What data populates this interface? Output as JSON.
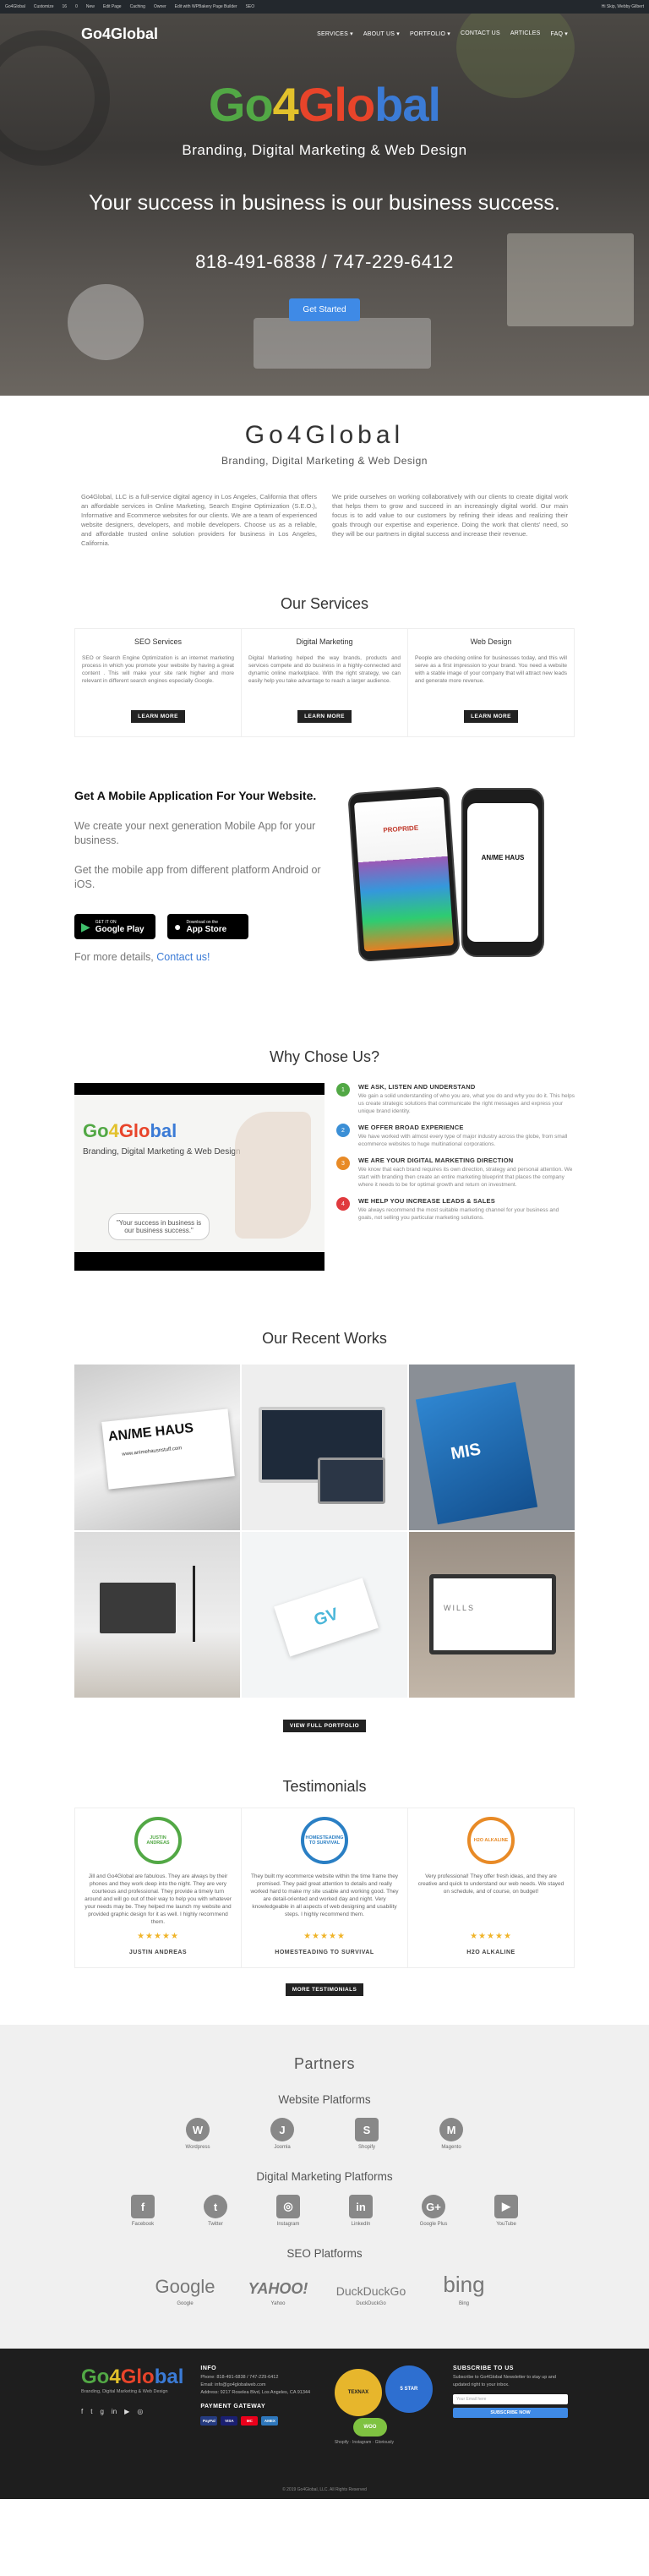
{
  "colors": {
    "accent": "#3f8ae6",
    "green": "#52a845",
    "blue": "#3b7bd6",
    "orange": "#e88a26",
    "red": "#e03a3e",
    "dark": "#222222"
  },
  "adminbar": {
    "items": [
      "Go4Global",
      "Customize",
      "16",
      "0",
      "New",
      "Edit Page",
      "Caching",
      "Owner",
      "Edit with WPBakery Page Builder",
      "SEO"
    ],
    "user": "Hi Skip, Webby Gilbert"
  },
  "nav": {
    "logo": "Go4Global",
    "items": [
      "SERVICES ▾",
      "ABOUT US ▾",
      "PORTFOLIO ▾",
      "CONTACT US",
      "ARTICLES",
      "FAQ ▾"
    ]
  },
  "hero": {
    "logo_parts": [
      "Go",
      "4",
      "Glo",
      "bal"
    ],
    "tagline": "Branding, Digital Marketing & Web Design",
    "headline": "Your success in business is our business success.",
    "phones": "818-491-6838 / 747-229-6412",
    "cta": "Get Started"
  },
  "intro": {
    "title": "Go4Global",
    "subtitle": "Branding, Digital Marketing & Web Design",
    "col1": "Go4Global, LLC is a full-service digital agency in Los Angeles, California that offers an affordable services in Online Marketing, Search Engine Optimization (S.E.O.), Informative and Ecommerce websites for our clients. We are a team of experienced website designers, developers, and mobile developers. Choose us as a reliable, and affordable trusted online solution providers for business in Los Angeles, California.",
    "col2": "We pride ourselves on working collaboratively with our clients to create digital work that helps them to grow and succeed in an increasingly digital world. Our main focus is to add value to our customers by refining their ideas and realizing their goals through our expertise and experience. Doing the work that clients' need, so they will be our partners in digital success and increase their revenue."
  },
  "services": {
    "title": "Our Services",
    "items": [
      {
        "title": "SEO Services",
        "text": "SEO or Search Engine Optimization is an internet marketing process in which you promote your website by having a great content . This will make your site rank higher and more relevant in different search engines especially Google.",
        "button": "LEARN MORE"
      },
      {
        "title": "Digital Marketing",
        "text": "Digital Marketing helped the way brands, products and services compete and do business in a highly-connected and dynamic online marketplace. With the right strategy, we can easily help you take advantage to reach a larger audience.",
        "button": "LEARN MORE"
      },
      {
        "title": "Web Design",
        "text": "People are checking online for businesses today, and this will serve as a first impression to your brand. You need a website with a stable image of your company that will attract new leads and generate more revenue.",
        "button": "LEARN MORE"
      }
    ]
  },
  "mobile": {
    "title": "Get A Mobile Application For Your Website.",
    "p1": "We create your next generation Mobile App for your business.",
    "p2": "Get the mobile app from different platform Android or iOS.",
    "google_small": "GET IT ON",
    "google_big": "Google Play",
    "apple_small": "Download on the",
    "apple_big": "App Store",
    "more_prefix": "For more details,",
    "more_link": "Contact us!",
    "screen_brand": "PROPRIDE",
    "screen_brand2": "AN/ME HAUS"
  },
  "why": {
    "title": "Why Chose Us?",
    "video": {
      "logo": "Go4Global",
      "tagline": "Branding, Digital Marketing & Web Design",
      "quote": "\"Your success in business is our business success.\""
    },
    "items": [
      {
        "n": "1",
        "title": "WE ASK, LISTEN AND UNDERSTAND",
        "text": "We gain a solid understanding of who you are, what you do and why you do it. This helps us create strategic solutions that communicate the right messages and express your unique brand identity."
      },
      {
        "n": "2",
        "title": "WE OFFER BROAD EXPERIENCE",
        "text": "We have worked with almost every type of major industry across the globe, from small ecommerce websites to huge multinational corporations."
      },
      {
        "n": "3",
        "title": "WE ARE YOUR DIGITAL MARKETING DIRECTION",
        "text": "We know that each brand requires its own direction, strategy and personal attention. We start with branding then create an entire marketing blueprint that places the company where it needs to be for optimal growth and return on investment."
      },
      {
        "n": "4",
        "title": "WE HELP YOU INCREASE LEADS & SALES",
        "text": "We always recommend the most suitable marketing channel for your business and goals, not selling you particular marketing solutions."
      }
    ]
  },
  "works": {
    "title": "Our Recent Works",
    "cells": [
      "AN/ME HAUS",
      "",
      "MIS",
      "",
      "GV",
      "WILLS"
    ],
    "url": "www.animehausnstuff.com",
    "button": "VIEW FULL PORTFOLIO"
  },
  "testimonials": {
    "title": "Testimonials",
    "items": [
      {
        "logo": "JUSTIN ANDREAS",
        "text": "Jill and Go4Global are fabulous. They are always by their phones and they work deep into the night. They are very courteous and professional. They provide a timely turn around and will go out of their way to help you with whatever your needs may be. They helped me launch my website and provided graphic design for it as well. I highly recommend them.",
        "stars": "★★★★★",
        "name": "JUSTIN ANDREAS"
      },
      {
        "logo": "HOMESTEADING TO SURVIVAL",
        "text": "They built my ecommerce website within the time frame they promised. They paid great attention to details and really worked hard to make my site usable and working good. They are detail-oriented and worked day and night. Very knowledgeable in all aspects of web designing and usability steps. I highly recommend them.",
        "stars": "★★★★★",
        "name": "HOMESTEADING TO SURVIVAL"
      },
      {
        "logo": "H2O ALKALINE",
        "text": "Very professional! They offer fresh ideas, and they are creative and quick to understand our web needs. We stayed on schedule, and of course, on budget!",
        "stars": "★★★★★",
        "name": "H2O ALKALINE"
      }
    ],
    "button": "MORE TESTIMONIALS"
  },
  "partners": {
    "title": "Partners",
    "website_title": "Website Platforms",
    "website": [
      {
        "icon": "W",
        "label": "Wordpress"
      },
      {
        "icon": "J",
        "label": "Joomla"
      },
      {
        "icon": "S",
        "label": "Shopify"
      },
      {
        "icon": "M",
        "label": "Magento"
      }
    ],
    "digital_title": "Digital Marketing Platforms",
    "digital": [
      {
        "icon": "f",
        "label": "Facebook"
      },
      {
        "icon": "t",
        "label": "Twitter"
      },
      {
        "icon": "◎",
        "label": "Instagram"
      },
      {
        "icon": "in",
        "label": "LinkedIn"
      },
      {
        "icon": "G+",
        "label": "Google Plus"
      },
      {
        "icon": "▶",
        "label": "YouTube"
      }
    ],
    "seo_title": "SEO Platforms",
    "seo": [
      {
        "word": "Google",
        "label": "Google"
      },
      {
        "word": "YAHOO!",
        "label": "Yahoo"
      },
      {
        "word": "DuckDuckGo",
        "label": "DuckDuckGo"
      },
      {
        "word": "bing",
        "label": "Bing"
      }
    ]
  },
  "footer": {
    "logo": "Go4Global",
    "logo_sub": "Branding, Digital Marketing & Web Design",
    "info_title": "INFO",
    "phone": "Phone: 818-491-6838 / 747-229-6412",
    "email": "Email: info@go4globalweb.com",
    "address": "Address: 9217 Roselea Blvd, Los Angeles, CA 91344",
    "payment_title": "PAYMENT GATEWAY",
    "payments": [
      "PayPal",
      "VISA",
      "MC",
      "AMEX"
    ],
    "badge1": "TEXNAX",
    "badge2": "5 STAR",
    "badge3": "WOO",
    "badge3_sub": "Shopify · Instagram · Gloriously",
    "subscribe_title": "SUBSCRIBE TO US",
    "subscribe_text": "Subscribe to Go4Global Newsletter to stay up and updated right to your inbox.",
    "email_placeholder": "Your Email here",
    "subscribe_button": "SUBSCRIBE NOW",
    "copyright": "© 2019 Go4Global, LLC. All Rights Reserved"
  }
}
